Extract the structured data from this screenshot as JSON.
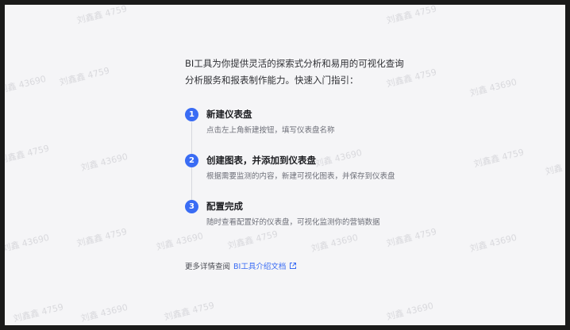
{
  "intro": {
    "line1": "BI工具为你提供灵活的探索式分析和易用的可视化查询",
    "line2": "分析服务和报表制作能力。快速入门指引："
  },
  "steps": [
    {
      "num": "1",
      "title": "新建仪表盘",
      "desc": "点击左上角新建按钮，填写仪表盘名称"
    },
    {
      "num": "2",
      "title": "创建图表，并添加到仪表盘",
      "desc": "根据需要监测的内容，新建可视化图表，并保存到仪表盘"
    },
    {
      "num": "3",
      "title": "配置完成",
      "desc": "随时查看配置好的仪表盘，可视化监测你的营销数据"
    }
  ],
  "footer": {
    "prefix": "更多详情查阅",
    "link_label": "BI工具介绍文档"
  },
  "watermark": {
    "name_text": "刘鑫鑫 4759",
    "id_text": "刘鑫 43690"
  },
  "colors": {
    "accent": "#3a6cf4",
    "background": "#f5f5f7"
  }
}
